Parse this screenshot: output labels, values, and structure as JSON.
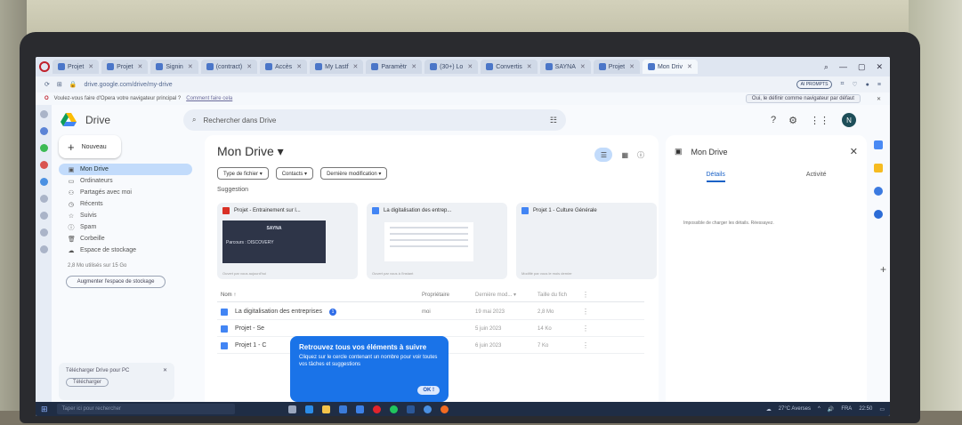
{
  "browser": {
    "tabs": [
      {
        "label": "Projet",
        "active": false
      },
      {
        "label": "Projet",
        "active": false
      },
      {
        "label": "Signin",
        "active": false
      },
      {
        "label": "(contract)",
        "active": false
      },
      {
        "label": "Accès",
        "active": false
      },
      {
        "label": "My Lastf",
        "active": false
      },
      {
        "label": "Paramètr",
        "active": false
      },
      {
        "label": "(30+) Lo",
        "active": false
      },
      {
        "label": "Convertis",
        "active": false
      },
      {
        "label": "SAYNA",
        "active": false
      },
      {
        "label": "Projet",
        "active": false
      },
      {
        "label": "Mon Driv",
        "active": true
      }
    ],
    "url": "drive.google.com/drive/my-drive",
    "ai_prompts": "AI PROMPTS",
    "notification": {
      "text": "Voulez-vous faire d'Opera votre navigateur principal ?",
      "link": "Comment faire cela",
      "button": "Oui, le définir comme navigateur par défaut"
    }
  },
  "drive": {
    "app_name": "Drive",
    "search_placeholder": "Rechercher dans Drive",
    "avatar_letter": "N",
    "new_button": "Nouveau",
    "nav": [
      {
        "label": "Mon Drive",
        "icon": "▣",
        "selected": true
      },
      {
        "label": "Ordinateurs",
        "icon": "▭",
        "selected": false
      },
      {
        "label": "Partagés avec moi",
        "icon": "⚇",
        "selected": false
      },
      {
        "label": "Récents",
        "icon": "◷",
        "selected": false
      },
      {
        "label": "Suivis",
        "icon": "☆",
        "selected": false
      },
      {
        "label": "Spam",
        "icon": "ⓘ",
        "selected": false
      },
      {
        "label": "Corbeille",
        "icon": "🗑",
        "selected": false
      },
      {
        "label": "Espace de stockage",
        "icon": "☁",
        "selected": false
      }
    ],
    "storage_text": "2,8 Mo utilisés sur 15 Go",
    "upgrade_button": "Augmenter l'espace de stockage",
    "download_card": {
      "text": "Télécharger Drive pour PC",
      "button": "Télécharger"
    },
    "page_title": "Mon Drive ▾",
    "filters": [
      "Type de fichier ▾",
      "Contacts ▾",
      "Dernière modification ▾"
    ],
    "suggestion_label": "Suggestion",
    "suggestions": [
      {
        "title": "Projet - Entrainement sur l...",
        "sub": "Ouvert par vous aujourd'hui",
        "thumb_brand": "SAYNA",
        "thumb_text": "Parcours : DISCOVERY",
        "color": "#d93025"
      },
      {
        "title": "La digitalisation des entrep...",
        "sub": "Ouvert par vous à l'instant",
        "color": "#4285f4"
      },
      {
        "title": "Projet 1 - Culture Générale",
        "sub": "Modifié par vous le mois dernier",
        "color": "#4285f4"
      }
    ],
    "table": {
      "headers": [
        "Nom ↑",
        "Propriétaire",
        "Dernière mod... ▾",
        "Taille du fich"
      ],
      "rows": [
        {
          "name": "La digitalisation des entreprises",
          "owner": "moi",
          "date": "19 mai 2023",
          "size": "2,8 Mo"
        },
        {
          "name": "Projet - Se",
          "owner": "",
          "date": "5 juin 2023",
          "size": "14 Ko"
        },
        {
          "name": "Projet 1 - C",
          "owner": "",
          "date": "6 juin 2023",
          "size": "7 Ko"
        }
      ]
    },
    "tooltip": {
      "title": "Retrouvez tous vos éléments à suivre",
      "body": "Cliquez sur le cercle contenant un nombre pour voir toutes vos tâches et suggestions",
      "ok": "OK !"
    },
    "details": {
      "title": "Mon Drive",
      "tabs": [
        "Détails",
        "Activité"
      ],
      "message": "Impossible de charger les détails. Réessayez."
    }
  },
  "taskbar": {
    "search_placeholder": "Taper ici pour rechercher",
    "weather": "27°C Averses",
    "lang": "FRA",
    "time": "22:50"
  }
}
